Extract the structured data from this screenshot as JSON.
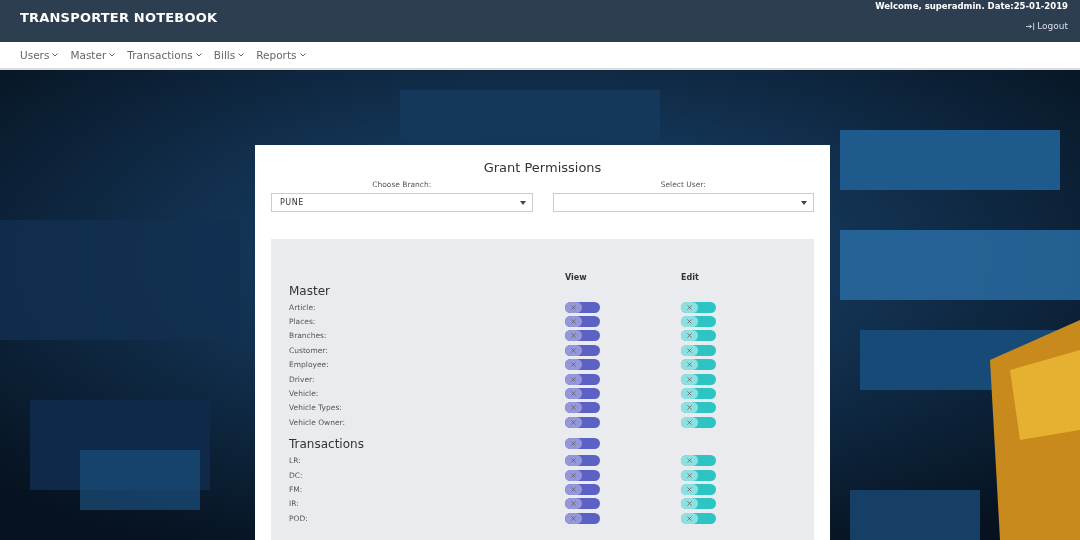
{
  "header": {
    "brand": "TRANSPORTER NOTEBOOK",
    "welcome": "Welcome, superadmin. Date:25-01-2019",
    "logout": "Logout"
  },
  "menu": [
    {
      "label": "Users"
    },
    {
      "label": "Master"
    },
    {
      "label": "Transactions"
    },
    {
      "label": "Bills"
    },
    {
      "label": "Reports"
    }
  ],
  "card": {
    "title": "Grant Permissions",
    "branch": {
      "label": "Choose Branch:",
      "value": "PUNE"
    },
    "user": {
      "label": "Select User:"
    },
    "columns": [
      "View",
      "Edit"
    ],
    "sections": [
      {
        "title": "Master",
        "rows": [
          {
            "label": "Article:",
            "view": false,
            "edit": false
          },
          {
            "label": "Places:",
            "view": false,
            "edit": false
          },
          {
            "label": "Branches:",
            "view": false,
            "edit": false
          },
          {
            "label": "Customer:",
            "view": false,
            "edit": false
          },
          {
            "label": "Employee:",
            "view": false,
            "edit": false
          },
          {
            "label": "Driver:",
            "view": false,
            "edit": false
          },
          {
            "label": "Vehicle:",
            "view": false,
            "edit": false
          },
          {
            "label": "Vehicle Types:",
            "view": false,
            "edit": false
          },
          {
            "label": "Vehicle Owner:",
            "view": false,
            "edit": false
          }
        ]
      },
      {
        "title": "Transactions",
        "header_toggles": [
          {
            "kind": "view",
            "on": false
          }
        ],
        "rows": [
          {
            "label": "LR:",
            "view": false,
            "edit": false
          },
          {
            "label": "DC:",
            "view": false,
            "edit": false
          },
          {
            "label": "FM:",
            "view": false,
            "edit": false
          },
          {
            "label": "IR:",
            "view": false,
            "edit": false
          },
          {
            "label": "POD:",
            "view": false,
            "edit": false
          }
        ]
      }
    ]
  }
}
